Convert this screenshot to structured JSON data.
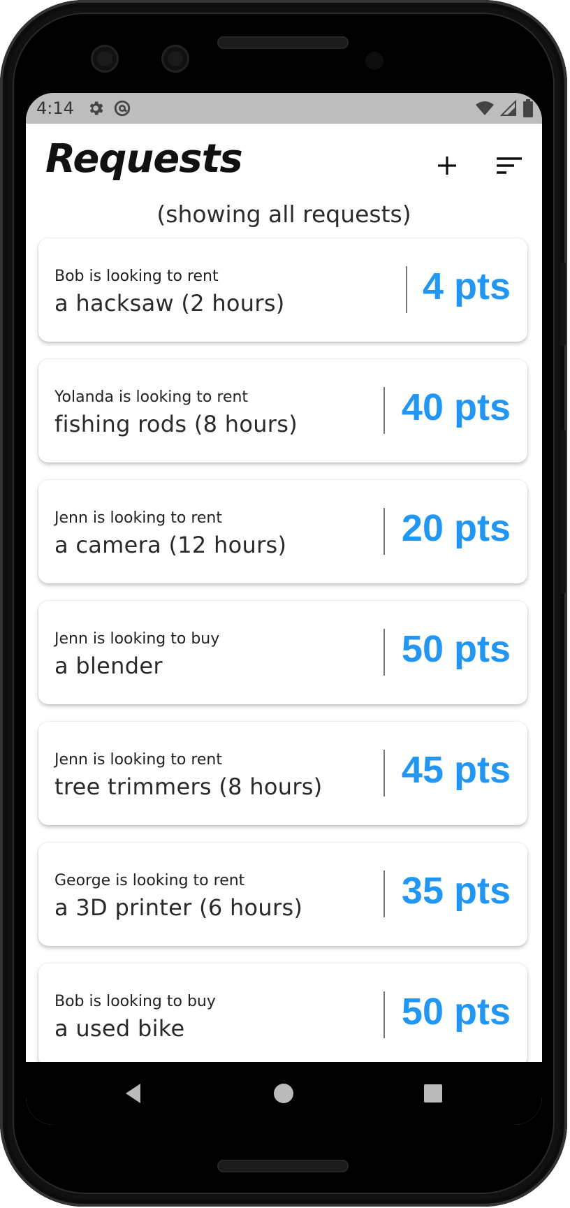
{
  "status_bar": {
    "time": "4:14",
    "left_icons": [
      "settings-gear-icon",
      "at-sign-icon"
    ],
    "right_icons": [
      "wifi-icon",
      "cell-signal-icon",
      "battery-icon"
    ]
  },
  "header": {
    "title": "Requests",
    "subtitle": "(showing all requests)",
    "add_icon": "plus-icon",
    "sort_icon": "sort-icon"
  },
  "requests": [
    {
      "who": "Bob is looking to rent",
      "what": "a hacksaw (2 hours)",
      "points": "4 pts"
    },
    {
      "who": "Yolanda is looking to rent",
      "what": "fishing rods (8 hours)",
      "points": "40 pts"
    },
    {
      "who": "Jenn is looking to rent",
      "what": "a camera (12 hours)",
      "points": "20 pts"
    },
    {
      "who": "Jenn is looking to buy",
      "what": "a blender",
      "points": "50 pts"
    },
    {
      "who": "Jenn is looking to rent",
      "what": "tree trimmers (8 hours)",
      "points": "45 pts"
    },
    {
      "who": "George is looking to rent",
      "what": "a 3D printer (6 hours)",
      "points": "35 pts"
    },
    {
      "who": "Bob is looking to buy",
      "what": "a used bike",
      "points": "50 pts"
    }
  ],
  "nav_bar": {
    "back_icon": "back-triangle-icon",
    "home_icon": "home-circle-icon",
    "recents_icon": "recents-square-icon"
  },
  "colors": {
    "points_blue": "#2196f3",
    "status_bar_gray": "#bdbdbd"
  }
}
